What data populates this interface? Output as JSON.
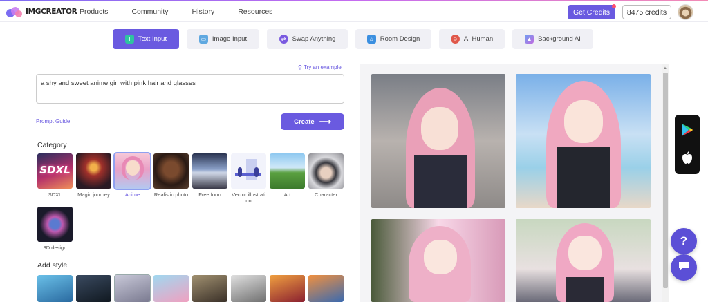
{
  "brand": {
    "name": "IMGCREATOR"
  },
  "nav": [
    "Products",
    "Community",
    "History",
    "Resources"
  ],
  "header": {
    "get_credits": "Get Credits",
    "credits": "8475 credits"
  },
  "tabs": [
    {
      "label": "Text Input",
      "icon": "text-icon",
      "active": true
    },
    {
      "label": "Image Input",
      "icon": "image-icon"
    },
    {
      "label": "Swap Anything",
      "icon": "swap-icon"
    },
    {
      "label": "Room Design",
      "icon": "room-icon"
    },
    {
      "label": "AI Human",
      "icon": "human-icon"
    },
    {
      "label": "Background AI",
      "icon": "background-icon"
    }
  ],
  "prompt": {
    "try_example": "Try an example",
    "value": "a shy and sweet anime girl with pink hair and glasses",
    "guide": "Prompt Guide",
    "create": "Create"
  },
  "category": {
    "title": "Category",
    "items": [
      {
        "label": "SDXL"
      },
      {
        "label": "Magic journey"
      },
      {
        "label": "Anime",
        "selected": true
      },
      {
        "label": "Realistic photo"
      },
      {
        "label": "Free form"
      },
      {
        "label": "Vector illustration"
      },
      {
        "label": "Art"
      },
      {
        "label": "Character"
      },
      {
        "label": "3D design"
      }
    ]
  },
  "add_style": {
    "title": "Add style"
  },
  "help": {
    "label": "?"
  },
  "colors": {
    "accent": "#6a5ae0",
    "accent_light": "#8fa0f0"
  }
}
